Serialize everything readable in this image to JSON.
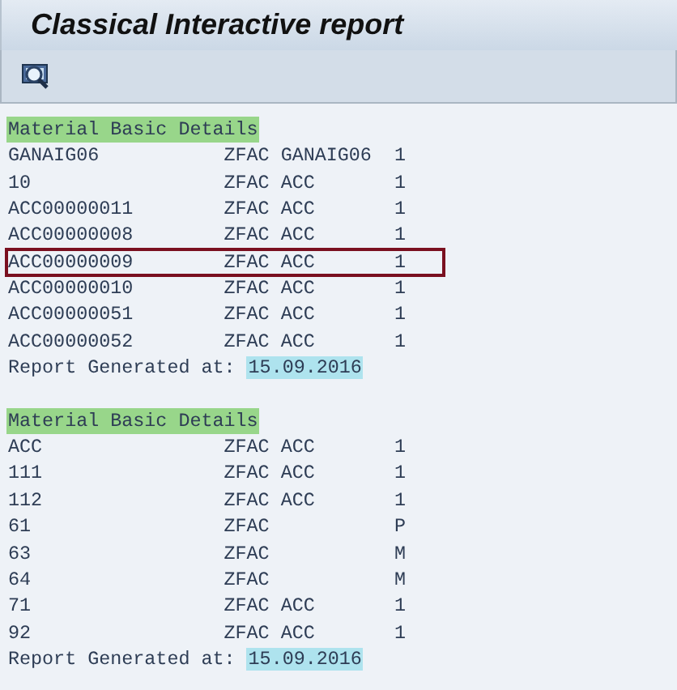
{
  "window": {
    "title": "Classical Interactive report"
  },
  "toolbar": [
    {
      "kind": "search"
    }
  ],
  "sections": [
    {
      "header": "Material Basic Details",
      "rows": [
        {
          "column_1": "GANAIG06",
          "column_2": "ZFAC",
          "column_3": "GANAIG06",
          "column_4": "1",
          "selected": false
        },
        {
          "column_1": "10",
          "column_2": "ZFAC",
          "column_3": "ACC",
          "column_4": "1",
          "selected": false
        },
        {
          "column_1": "ACC00000011",
          "column_2": "ZFAC",
          "column_3": "ACC",
          "column_4": "1",
          "selected": false
        },
        {
          "column_1": "ACC00000008",
          "column_2": "ZFAC",
          "column_3": "ACC",
          "column_4": "1",
          "selected": false
        },
        {
          "column_1": "ACC00000009",
          "column_2": "ZFAC",
          "column_3": "ACC",
          "column_4": "1",
          "selected": true
        },
        {
          "column_1": "ACC00000010",
          "column_2": "ZFAC",
          "column_3": "ACC",
          "column_4": "1",
          "selected": false
        },
        {
          "column_1": "ACC00000051",
          "column_2": "ZFAC",
          "column_3": "ACC",
          "column_4": "1",
          "selected": false
        },
        {
          "column_1": "ACC00000052",
          "column_2": "ZFAC",
          "column_3": "ACC",
          "column_4": "1",
          "selected": false
        }
      ],
      "footer_label": "Report Generated at:",
      "footer_date": "15.09.2016"
    },
    {
      "header": "Material Basic Details",
      "rows": [
        {
          "column_1": "ACC",
          "column_2": "ZFAC",
          "column_3": "ACC",
          "column_4": "1",
          "selected": false
        },
        {
          "column_1": "111",
          "column_2": "ZFAC",
          "column_3": "ACC",
          "column_4": "1",
          "selected": false
        },
        {
          "column_1": "112",
          "column_2": "ZFAC",
          "column_3": "ACC",
          "column_4": "1",
          "selected": false
        },
        {
          "column_1": "61",
          "column_2": "ZFAC",
          "column_4": "P",
          "selected": false
        },
        {
          "column_1": "63",
          "column_2": "ZFAC",
          "column_4": "M",
          "selected": false
        },
        {
          "column_1": "64",
          "column_2": "ZFAC",
          "column_4": "M",
          "selected": false
        },
        {
          "column_1": "71",
          "column_2": "ZFAC",
          "column_3": "ACC",
          "column_4": "1",
          "selected": false
        },
        {
          "column_1": "92",
          "column_2": "ZFAC",
          "column_3": "ACC",
          "column_4": "1",
          "selected": false
        }
      ],
      "footer_label": "Report Generated at:",
      "footer_date": "15.09.2016"
    }
  ]
}
